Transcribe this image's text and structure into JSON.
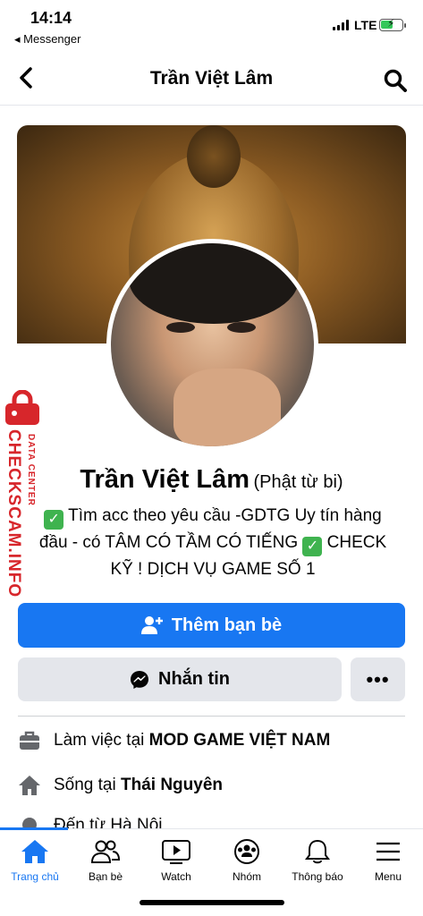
{
  "status_bar": {
    "time": "14:14",
    "back_app": "◂ Messenger",
    "network": "LTE"
  },
  "header": {
    "title": "Trần Việt Lâm"
  },
  "profile": {
    "name": "Trần Việt Lâm",
    "alt_name": "(Phật từ bi)",
    "bio_line1": " Tìm acc theo yêu cầu -GDTG Uy tín hàng",
    "bio_line2": "đầu - có TÂM CÓ TẦM CÓ TIẾNG ",
    "bio_line2_end": " CHECK",
    "bio_line3": "KỸ ! DỊCH VỤ GAME SỐ 1"
  },
  "watermark": {
    "main": "CHECKSCAM.INFO",
    "sub": "DATA CENTER"
  },
  "actions": {
    "add_friend": "Thêm bạn bè",
    "message": "Nhắn tin",
    "more": "•••"
  },
  "details": [
    {
      "prefix": "Làm việc tại ",
      "value": "MOD GAME VIỆT NAM",
      "icon": "briefcase-icon"
    },
    {
      "prefix": "Sống tại ",
      "value": "Thái Nguyên",
      "icon": "home-icon"
    },
    {
      "prefix": "Đến từ ",
      "value": "Hà Nội",
      "icon": "location-icon"
    }
  ],
  "tabs": [
    {
      "label": "Trang chủ",
      "icon": "home-icon",
      "active": true
    },
    {
      "label": "Bạn bè",
      "icon": "friends-icon"
    },
    {
      "label": "Watch",
      "icon": "watch-icon"
    },
    {
      "label": "Nhóm",
      "icon": "groups-icon"
    },
    {
      "label": "Thông báo",
      "icon": "bell-icon"
    },
    {
      "label": "Menu",
      "icon": "menu-icon"
    }
  ],
  "colors": {
    "accent": "#1877f2",
    "watermark": "#d7262b",
    "check": "#3fb34f"
  }
}
